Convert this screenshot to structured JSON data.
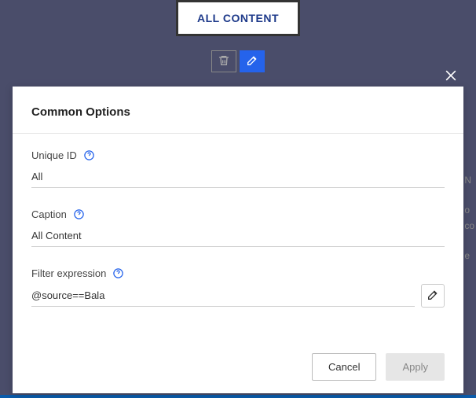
{
  "tab": {
    "label": "ALL CONTENT"
  },
  "modal": {
    "title": "Common Options",
    "fields": {
      "unique_id": {
        "label": "Unique ID",
        "value": "All"
      },
      "caption": {
        "label": "Caption",
        "value": "All Content"
      },
      "filter_expression": {
        "label": "Filter expression",
        "value": "@source==Bala"
      }
    },
    "buttons": {
      "cancel": "Cancel",
      "apply": "Apply"
    }
  }
}
